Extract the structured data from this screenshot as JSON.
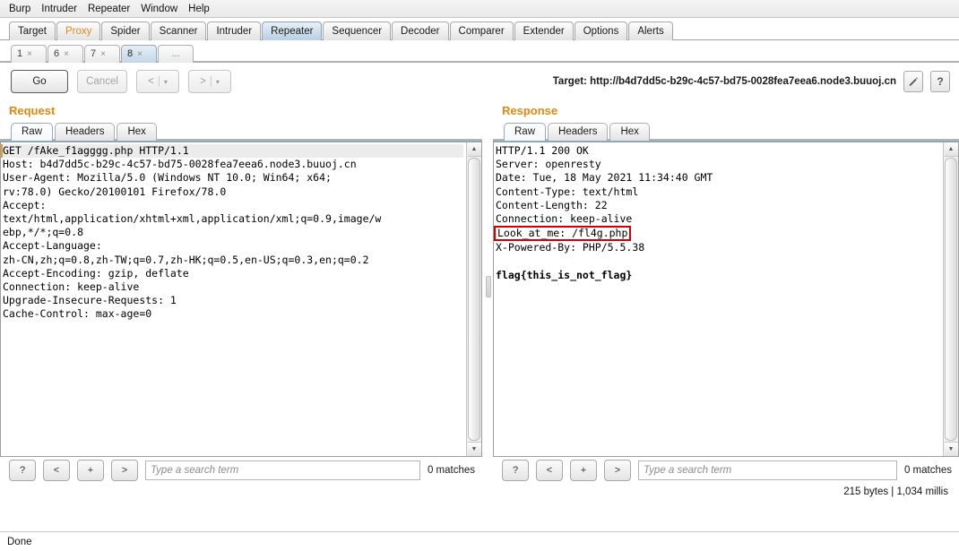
{
  "menu": {
    "items": [
      "Burp",
      "Intruder",
      "Repeater",
      "Window",
      "Help"
    ]
  },
  "main_tabs": [
    {
      "label": "Target",
      "active": false
    },
    {
      "label": "Proxy",
      "active": false
    },
    {
      "label": "Spider",
      "active": false
    },
    {
      "label": "Scanner",
      "active": false
    },
    {
      "label": "Intruder",
      "active": false
    },
    {
      "label": "Repeater",
      "active": true
    },
    {
      "label": "Sequencer",
      "active": false
    },
    {
      "label": "Decoder",
      "active": false
    },
    {
      "label": "Comparer",
      "active": false
    },
    {
      "label": "Extender",
      "active": false
    },
    {
      "label": "Options",
      "active": false
    },
    {
      "label": "Alerts",
      "active": false
    }
  ],
  "repeater_tabs": [
    {
      "label": "1",
      "close": "×",
      "active": false
    },
    {
      "label": "6",
      "close": "×",
      "active": false
    },
    {
      "label": "7",
      "close": "×",
      "active": false
    },
    {
      "label": "8",
      "close": "×",
      "active": true
    },
    {
      "label": "...",
      "close": "",
      "active": false
    }
  ],
  "toolbar": {
    "go_label": "Go",
    "cancel_label": "Cancel",
    "back_label": "<",
    "forward_label": ">",
    "caret": "▾",
    "separator": "|",
    "target_label": "Target: http://b4d7dd5c-b29c-4c57-bd75-0028fea7eea6.node3.buuoj.cn",
    "help_label": "?"
  },
  "request": {
    "title": "Request",
    "tabs": [
      {
        "label": "Raw",
        "active": true
      },
      {
        "label": "Headers",
        "active": false
      },
      {
        "label": "Hex",
        "active": false
      }
    ],
    "first_line": "GET /fAke_f1agggg.php HTTP/1.1",
    "body": "Host: b4d7dd5c-b29c-4c57-bd75-0028fea7eea6.node3.buuoj.cn\nUser-Agent: Mozilla/5.0 (Windows NT 10.0; Win64; x64;\nrv:78.0) Gecko/20100101 Firefox/78.0\nAccept:\ntext/html,application/xhtml+xml,application/xml;q=0.9,image/w\nebp,*/*;q=0.8\nAccept-Language:\nzh-CN,zh;q=0.8,zh-TW;q=0.7,zh-HK;q=0.5,en-US;q=0.3,en;q=0.2\nAccept-Encoding: gzip, deflate\nConnection: keep-alive\nUpgrade-Insecure-Requests: 1\nCache-Control: max-age=0\n",
    "search": {
      "help_label": "?",
      "prev_label": "<",
      "add_label": "+",
      "next_label": ">",
      "placeholder": "Type a search term",
      "matches": "0 matches"
    }
  },
  "response": {
    "title": "Response",
    "tabs": [
      {
        "label": "Raw",
        "active": true
      },
      {
        "label": "Headers",
        "active": false
      },
      {
        "label": "Hex",
        "active": false
      }
    ],
    "headers_before": "HTTP/1.1 200 OK\nServer: openresty\nDate: Tue, 18 May 2021 11:34:40 GMT\nContent-Type: text/html\nContent-Length: 22\nConnection: keep-alive\n",
    "highlighted_header": "Look_at_me: /fl4g.php",
    "headers_after": "\nX-Powered-By: PHP/5.5.38\n\n",
    "body_text": "flag{this_is_not_flag}",
    "search": {
      "help_label": "?",
      "prev_label": "<",
      "add_label": "+",
      "next_label": ">",
      "placeholder": "Type a search term",
      "matches": "0 matches"
    },
    "stats": "215 bytes | 1,034 millis"
  },
  "statusbar": {
    "text": "Done"
  },
  "colors": {
    "accent_orange": "#e0890f",
    "highlight_red": "#d40000",
    "active_tab_blue": "#b9cfe2"
  }
}
